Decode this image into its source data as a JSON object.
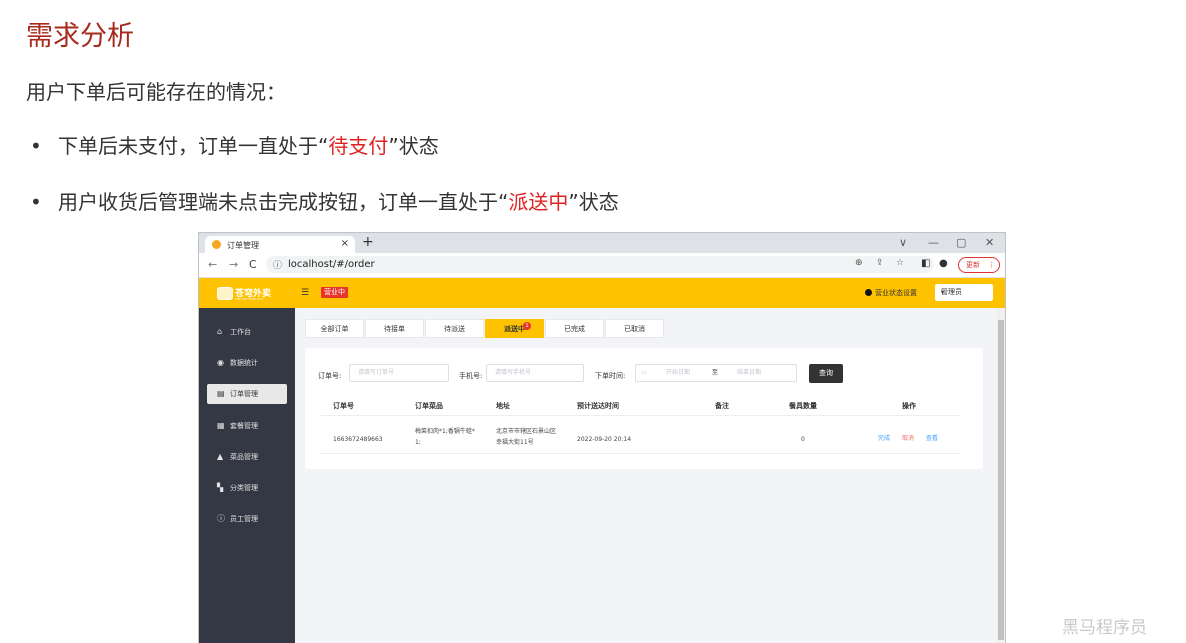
{
  "slide": {
    "title": "需求分析",
    "subtitle": "用户下单后可能存在的情况：",
    "bullet1_pre": "下单后未支付，订单一直处于“",
    "bullet1_hl": "待支付",
    "bullet1_post": "”状态",
    "bullet2_pre": "用户收货后管理端未点击完成按钮，订单一直处于“",
    "bullet2_hl": "派送中",
    "bullet2_post": "”状态",
    "bullet_dot": "•"
  },
  "browser": {
    "tab_title": "订单管理",
    "tab_close": "×",
    "new_tab": "+",
    "url": "localhost/#/order",
    "update_label": "更新",
    "win_min": "—",
    "win_max": "▢",
    "win_close": "✕",
    "win_dropdown": "∨",
    "nav_back": "←",
    "nav_forward": "→",
    "nav_reload": "C",
    "info_icon": "ⓘ",
    "zoom_icon": "⊕",
    "share_icon": "⇪",
    "star_icon": "☆",
    "sidepanel_icon": "◧",
    "profile_icon": "●",
    "kebab_icon": "⋮"
  },
  "app": {
    "brand": "苍穹外卖",
    "brand_en": "THE SKY TAKE OUT",
    "menu_icon": "☰",
    "status_badge": "营业中",
    "status_setting": "营业状态设置",
    "admin": "管理员",
    "admin_caret": "▾"
  },
  "sidebar": {
    "items": [
      {
        "label": "工作台",
        "icon": "⌂"
      },
      {
        "label": "数据统计",
        "icon": "◉"
      },
      {
        "label": "订单管理",
        "icon": "▤"
      },
      {
        "label": "套餐管理",
        "icon": "▦"
      },
      {
        "label": "菜品管理",
        "icon": "▲"
      },
      {
        "label": "分类管理",
        "icon": "▚"
      },
      {
        "label": "员工管理",
        "icon": "ⓘ"
      }
    ]
  },
  "order_tabs": [
    {
      "label": "全部订单"
    },
    {
      "label": "待接单"
    },
    {
      "label": "待派送"
    },
    {
      "label": "派送中",
      "badge": "1"
    },
    {
      "label": "已完成"
    },
    {
      "label": "已取消"
    }
  ],
  "filters": {
    "order_no_label": "订单号:",
    "order_no_placeholder": "请填写订单号",
    "phone_label": "手机号:",
    "phone_placeholder": "请填写手机号",
    "time_label": "下单时间:",
    "start_placeholder": "开始日期",
    "to": "至",
    "end_placeholder": "结束日期",
    "calendar_icon": "▭",
    "query_button": "查询"
  },
  "table": {
    "headers": [
      "订单号",
      "订单菜品",
      "地址",
      "预计送达时间",
      "备注",
      "餐具数量",
      "操作"
    ],
    "row": {
      "order_no": "1663672489663",
      "dishes_line1": "梅菜扣肉*1;香锅牛蛙*",
      "dishes_line2": "1;",
      "address_line1": "北京市市辖区石景山区",
      "address_line2": "幸福大街11号",
      "eta": "2022-09-20 20:14",
      "remark": "",
      "tableware": "0",
      "action_complete": "完成",
      "action_cancel": "取消",
      "action_view": "查看"
    }
  },
  "watermark": "黑马程序员",
  "colors": {
    "title_red": "#a82a1e",
    "highlight_red": "#e02020",
    "brand_yellow": "#ffc200",
    "sidebar_dark": "#343744",
    "status_red": "#e8352b",
    "link_blue": "#419eff",
    "cancel_red": "#f56c6c"
  }
}
